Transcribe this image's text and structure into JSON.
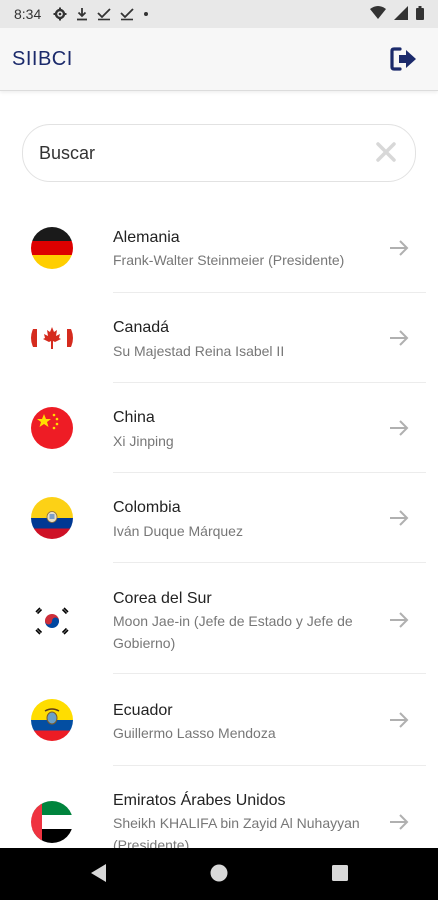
{
  "status_bar": {
    "time": "8:34"
  },
  "app_bar": {
    "title": "SIIBCI"
  },
  "search": {
    "placeholder": "Buscar"
  },
  "countries": [
    {
      "name": "Alemania",
      "leader": "Frank-Walter Steinmeier (Presidente)"
    },
    {
      "name": "Canadá",
      "leader": "Su Majestad Reina Isabel II"
    },
    {
      "name": "China",
      "leader": "Xi Jinping"
    },
    {
      "name": "Colombia",
      "leader": "Iván Duque Márquez"
    },
    {
      "name": "Corea del Sur",
      "leader": "Moon Jae-in (Jefe de Estado y Jefe de Gobierno)"
    },
    {
      "name": "Ecuador",
      "leader": "Guillermo Lasso Mendoza"
    },
    {
      "name": "Emiratos Árabes Unidos",
      "leader": "Sheikh KHALIFA bin Zayid Al Nuhayyan (Presidente)"
    }
  ],
  "colors": {
    "brand": "#1b2a6b",
    "arrow": "#b0b0b0",
    "divider": "#ececec"
  }
}
